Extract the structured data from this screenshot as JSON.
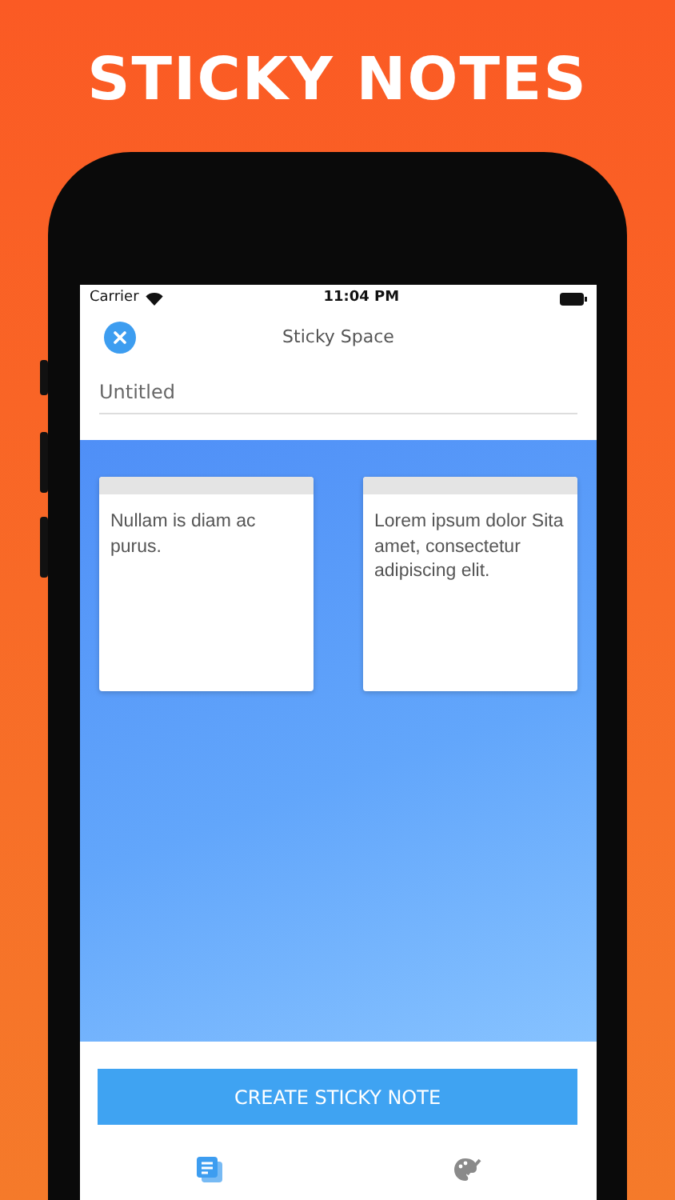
{
  "headline": "STICKY NOTES",
  "status_bar": {
    "carrier": "Carrier",
    "time": "11:04 PM"
  },
  "header": {
    "title": "Sticky Space"
  },
  "title_field": {
    "placeholder": "Untitled"
  },
  "notes": [
    {
      "text": "Nullam is diam ac purus."
    },
    {
      "text": "Lorem ipsum dolor Sita amet, consectetur adipiscing elit."
    }
  ],
  "create_button": "CREATE STICKY NOTE",
  "tabs": [
    {
      "kind": "notes",
      "selected": true
    },
    {
      "kind": "palette",
      "selected": false
    }
  ]
}
